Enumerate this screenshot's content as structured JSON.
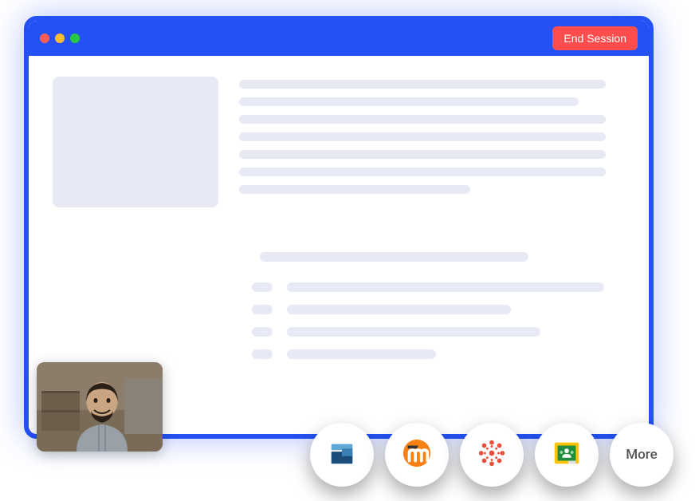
{
  "window": {
    "end_session_label": "End Session"
  },
  "integrations": {
    "item1_name": "schoology",
    "item2_name": "moodle",
    "item3_name": "canvas",
    "item4_name": "google-classroom",
    "more_label": "More"
  }
}
